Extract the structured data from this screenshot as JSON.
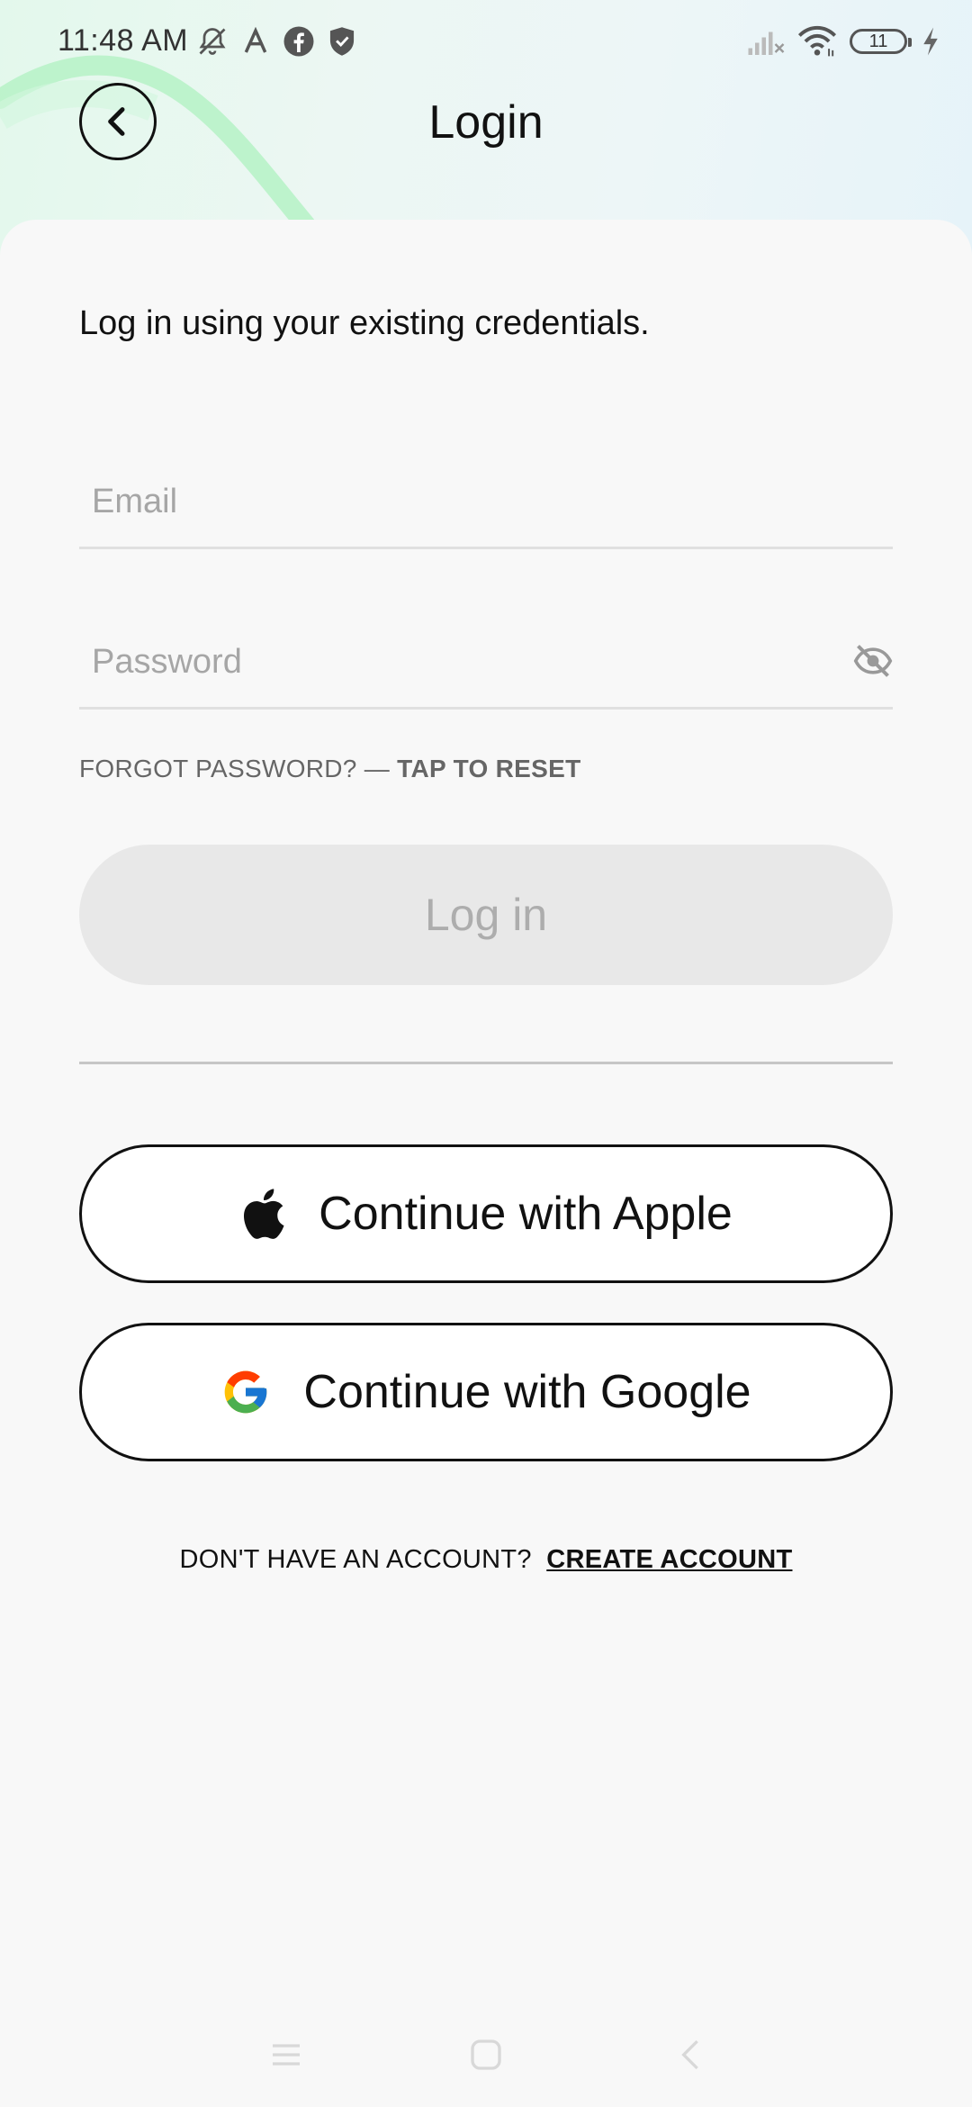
{
  "status_bar": {
    "time": "11:48 AM",
    "battery": "11",
    "icons_left": [
      "notifications-off-icon",
      "a-app-icon",
      "facebook-icon",
      "shield-icon"
    ],
    "icons_right": [
      "signal-icon",
      "wifi-icon",
      "battery-icon",
      "charging-icon"
    ]
  },
  "header": {
    "title": "Login",
    "back_icon": "chevron-left-icon"
  },
  "form": {
    "subtitle": "Log in using your existing credentials.",
    "email_placeholder": "Email",
    "email_value": "",
    "password_placeholder": "Password",
    "password_value": "",
    "password_toggle_icon": "eye-off-icon",
    "forgot_text": "FORGOT PASSWORD? —",
    "reset_link": "TAP TO RESET",
    "login_label": "Log in"
  },
  "social": {
    "apple_label": "Continue with Apple",
    "google_label": "Continue with Google"
  },
  "signup": {
    "prompt": "DON'T HAVE AN ACCOUNT?",
    "link": "CREATE ACCOUNT"
  },
  "colors": {
    "text": "#111111",
    "muted": "#666666",
    "placeholder": "#a6a6a6",
    "disabled_bg": "#e8e8e8",
    "disabled_text": "#adadad",
    "background": "#f8f8f8",
    "accent_green": "#b8f2c8"
  }
}
